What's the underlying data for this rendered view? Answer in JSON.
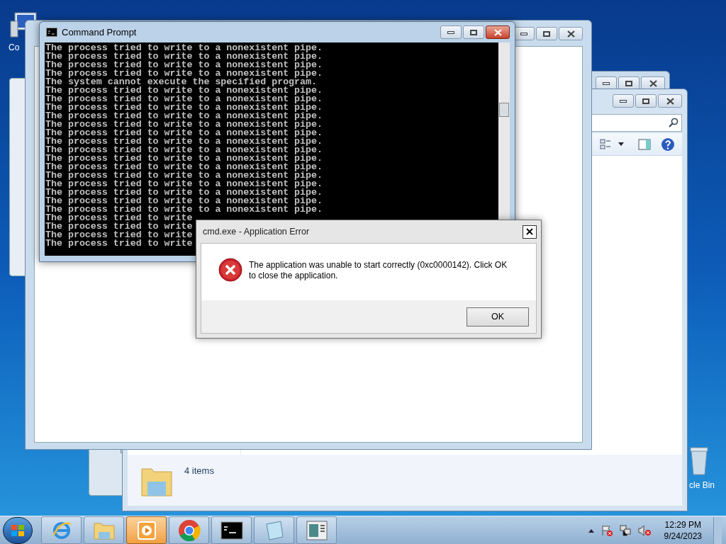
{
  "desktop_icons": [
    {
      "kind": "computer",
      "label": "Co"
    },
    {
      "kind": "recycle-bin",
      "label": "cle Bin"
    }
  ],
  "explorer": {
    "status": "4 items"
  },
  "console": {
    "title": "Command Prompt",
    "lines": [
      "The process tried to write to a nonexistent pipe.",
      "The process tried to write to a nonexistent pipe.",
      "The process tried to write to a nonexistent pipe.",
      "The process tried to write to a nonexistent pipe.",
      "The system cannot execute the specified program.",
      "The process tried to write to a nonexistent pipe.",
      "The process tried to write to a nonexistent pipe.",
      "The process tried to write to a nonexistent pipe.",
      "The process tried to write to a nonexistent pipe.",
      "The process tried to write to a nonexistent pipe.",
      "The process tried to write to a nonexistent pipe.",
      "The process tried to write to a nonexistent pipe.",
      "The process tried to write to a nonexistent pipe.",
      "The process tried to write to a nonexistent pipe.",
      "The process tried to write to a nonexistent pipe.",
      "The process tried to write to a nonexistent pipe.",
      "The process tried to write to a nonexistent pipe.",
      "The process tried to write to a nonexistent pipe.",
      "The process tried to write to a nonexistent pipe.",
      "The process tried to write to a nonexistent pipe.",
      "The process tried to write",
      "The process tried to write",
      "The process tried to write",
      "The process tried to write"
    ]
  },
  "dialog": {
    "title": "cmd.exe - Application Error",
    "message": "The application was unable to start correctly (0xc0000142). Click OK to close the application.",
    "button": "OK"
  },
  "taskbar": {
    "apps": [
      {
        "kind": "browser-e",
        "highlighted": false
      },
      {
        "kind": "folder",
        "highlighted": false
      },
      {
        "kind": "media",
        "highlighted": true
      },
      {
        "kind": "chrome",
        "highlighted": false
      },
      {
        "kind": "console",
        "highlighted": false
      },
      {
        "kind": "notepad",
        "highlighted": false
      },
      {
        "kind": "window",
        "highlighted": false
      }
    ],
    "time": "12:29 PM",
    "date": "9/24/2023"
  }
}
